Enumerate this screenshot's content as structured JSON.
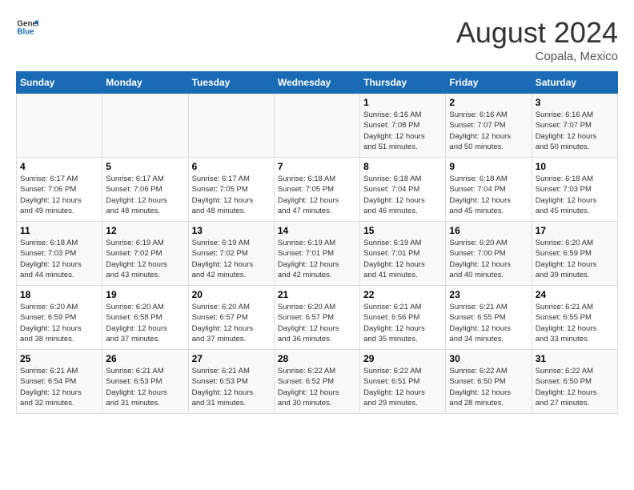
{
  "header": {
    "logo_general": "General",
    "logo_blue": "Blue",
    "month_title": "August 2024",
    "location": "Copala, Mexico"
  },
  "days_of_week": [
    "Sunday",
    "Monday",
    "Tuesday",
    "Wednesday",
    "Thursday",
    "Friday",
    "Saturday"
  ],
  "weeks": [
    [
      {
        "day": "",
        "info": ""
      },
      {
        "day": "",
        "info": ""
      },
      {
        "day": "",
        "info": ""
      },
      {
        "day": "",
        "info": ""
      },
      {
        "day": "1",
        "info": "Sunrise: 6:16 AM\nSunset: 7:08 PM\nDaylight: 12 hours\nand 51 minutes."
      },
      {
        "day": "2",
        "info": "Sunrise: 6:16 AM\nSunset: 7:07 PM\nDaylight: 12 hours\nand 50 minutes."
      },
      {
        "day": "3",
        "info": "Sunrise: 6:16 AM\nSunset: 7:07 PM\nDaylight: 12 hours\nand 50 minutes."
      }
    ],
    [
      {
        "day": "4",
        "info": "Sunrise: 6:17 AM\nSunset: 7:06 PM\nDaylight: 12 hours\nand 49 minutes."
      },
      {
        "day": "5",
        "info": "Sunrise: 6:17 AM\nSunset: 7:06 PM\nDaylight: 12 hours\nand 48 minutes."
      },
      {
        "day": "6",
        "info": "Sunrise: 6:17 AM\nSunset: 7:05 PM\nDaylight: 12 hours\nand 48 minutes."
      },
      {
        "day": "7",
        "info": "Sunrise: 6:18 AM\nSunset: 7:05 PM\nDaylight: 12 hours\nand 47 minutes."
      },
      {
        "day": "8",
        "info": "Sunrise: 6:18 AM\nSunset: 7:04 PM\nDaylight: 12 hours\nand 46 minutes."
      },
      {
        "day": "9",
        "info": "Sunrise: 6:18 AM\nSunset: 7:04 PM\nDaylight: 12 hours\nand 45 minutes."
      },
      {
        "day": "10",
        "info": "Sunrise: 6:18 AM\nSunset: 7:03 PM\nDaylight: 12 hours\nand 45 minutes."
      }
    ],
    [
      {
        "day": "11",
        "info": "Sunrise: 6:18 AM\nSunset: 7:03 PM\nDaylight: 12 hours\nand 44 minutes."
      },
      {
        "day": "12",
        "info": "Sunrise: 6:19 AM\nSunset: 7:02 PM\nDaylight: 12 hours\nand 43 minutes."
      },
      {
        "day": "13",
        "info": "Sunrise: 6:19 AM\nSunset: 7:02 PM\nDaylight: 12 hours\nand 42 minutes."
      },
      {
        "day": "14",
        "info": "Sunrise: 6:19 AM\nSunset: 7:01 PM\nDaylight: 12 hours\nand 42 minutes."
      },
      {
        "day": "15",
        "info": "Sunrise: 6:19 AM\nSunset: 7:01 PM\nDaylight: 12 hours\nand 41 minutes."
      },
      {
        "day": "16",
        "info": "Sunrise: 6:20 AM\nSunset: 7:00 PM\nDaylight: 12 hours\nand 40 minutes."
      },
      {
        "day": "17",
        "info": "Sunrise: 6:20 AM\nSunset: 6:59 PM\nDaylight: 12 hours\nand 39 minutes."
      }
    ],
    [
      {
        "day": "18",
        "info": "Sunrise: 6:20 AM\nSunset: 6:59 PM\nDaylight: 12 hours\nand 38 minutes."
      },
      {
        "day": "19",
        "info": "Sunrise: 6:20 AM\nSunset: 6:58 PM\nDaylight: 12 hours\nand 37 minutes."
      },
      {
        "day": "20",
        "info": "Sunrise: 6:20 AM\nSunset: 6:57 PM\nDaylight: 12 hours\nand 37 minutes."
      },
      {
        "day": "21",
        "info": "Sunrise: 6:20 AM\nSunset: 6:57 PM\nDaylight: 12 hours\nand 36 minutes."
      },
      {
        "day": "22",
        "info": "Sunrise: 6:21 AM\nSunset: 6:56 PM\nDaylight: 12 hours\nand 35 minutes."
      },
      {
        "day": "23",
        "info": "Sunrise: 6:21 AM\nSunset: 6:55 PM\nDaylight: 12 hours\nand 34 minutes."
      },
      {
        "day": "24",
        "info": "Sunrise: 6:21 AM\nSunset: 6:55 PM\nDaylight: 12 hours\nand 33 minutes."
      }
    ],
    [
      {
        "day": "25",
        "info": "Sunrise: 6:21 AM\nSunset: 6:54 PM\nDaylight: 12 hours\nand 32 minutes."
      },
      {
        "day": "26",
        "info": "Sunrise: 6:21 AM\nSunset: 6:53 PM\nDaylight: 12 hours\nand 31 minutes."
      },
      {
        "day": "27",
        "info": "Sunrise: 6:21 AM\nSunset: 6:53 PM\nDaylight: 12 hours\nand 31 minutes."
      },
      {
        "day": "28",
        "info": "Sunrise: 6:22 AM\nSunset: 6:52 PM\nDaylight: 12 hours\nand 30 minutes."
      },
      {
        "day": "29",
        "info": "Sunrise: 6:22 AM\nSunset: 6:51 PM\nDaylight: 12 hours\nand 29 minutes."
      },
      {
        "day": "30",
        "info": "Sunrise: 6:22 AM\nSunset: 6:50 PM\nDaylight: 12 hours\nand 28 minutes."
      },
      {
        "day": "31",
        "info": "Sunrise: 6:22 AM\nSunset: 6:50 PM\nDaylight: 12 hours\nand 27 minutes."
      }
    ]
  ]
}
